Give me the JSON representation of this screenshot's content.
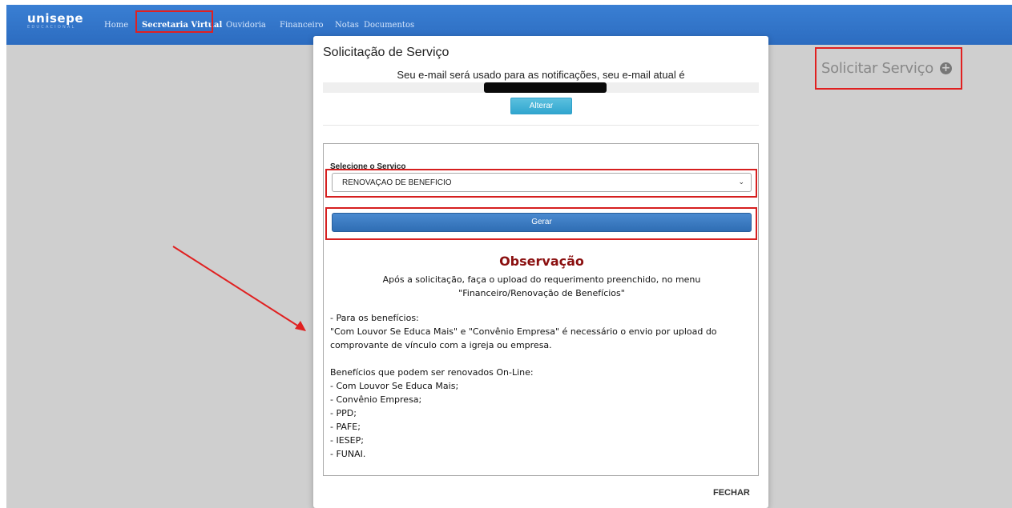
{
  "navbar": {
    "brand": "unisepe",
    "brand_sub": "EDUCACIONAL",
    "items": [
      {
        "label": "Home"
      },
      {
        "label": "Secretaria Virtual"
      },
      {
        "label": "Ouvidoria"
      },
      {
        "label": "Financeiro"
      },
      {
        "label": "Notas"
      },
      {
        "label": "Documentos"
      }
    ]
  },
  "side": {
    "solicitar_label": "Solicitar Serviço",
    "plus_icon": "plus-circle-icon",
    "plus_glyph": "+"
  },
  "modal": {
    "title": "Solicitação de Serviço",
    "email_notice": "Seu e-mail será usado para as notificações, seu e-mail atual é",
    "alterar_label": "Alterar",
    "select_label": "Selecione o Servico",
    "select_value": "RENOVAÇAO DE BENEFICIO",
    "select_chevron": "⌄",
    "gerar_label": "Gerar",
    "obs_title": "Observação",
    "obs_line1": "Após a solicitação, faça o upload do requerimento preenchido, no menu",
    "obs_line2": "\"Financeiro/Renovação de Benefícios\"",
    "body": [
      "- Para os benefícios:",
      "\"Com Louvor Se Educa Mais\" e \"Convênio Empresa\" é necessário o envio por upload do",
      "comprovante de vínculo com a igreja ou empresa.",
      "",
      "Benefícios que podem ser renovados On-Line:",
      "- Com Louvor Se Educa Mais;",
      "- Convênio Empresa;",
      "- PPD;",
      "- PAFE;",
      "- IESEP;",
      "- FUNAI."
    ],
    "fechar_label": "FECHAR"
  },
  "colors": {
    "nav_blue": "#2c6cc0",
    "highlight_red": "#e02020",
    "obs_red": "#8b1010",
    "backdrop": "#cfcfcf"
  }
}
